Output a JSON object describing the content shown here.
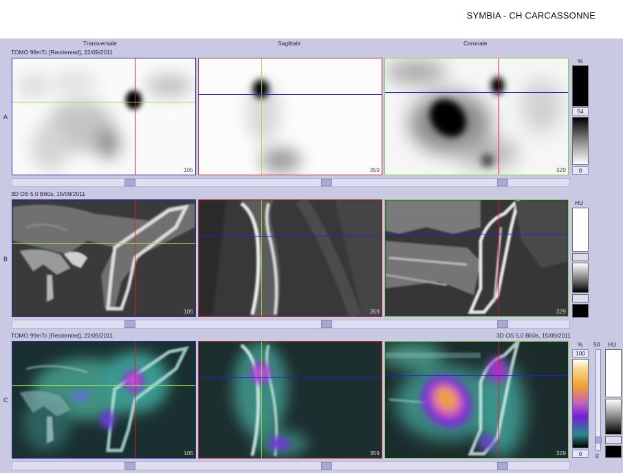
{
  "header": {
    "title": "SYMBIA - CH CARCASSONNE"
  },
  "views": {
    "transverse": "Transversale",
    "sagittal": "Sagittale",
    "coronal": "Coronale"
  },
  "rows": [
    {
      "label": "A",
      "series_left": "TOMO 99mTc [Reoriented], 22/09/2011",
      "series_right": "",
      "slices": [
        "105",
        "359",
        "329"
      ]
    },
    {
      "label": "B",
      "series_left": "3D  OS  5.0  B60s, 15/09/2011",
      "series_right": "",
      "slices": [
        "105",
        "359",
        "329"
      ]
    },
    {
      "label": "C",
      "series_left": "TOMO 99mTc [Reoriented], 22/09/2011",
      "series_right": "3D  OS  5.0  B60s, 15/09/2011",
      "slices": [
        "105",
        "359",
        "329"
      ]
    }
  ],
  "scales": {
    "nm": {
      "unit": "%",
      "value": "54",
      "min": "0"
    },
    "ct": {
      "unit": "HU"
    },
    "fusion": {
      "unit": "%",
      "max": "100",
      "min": "0",
      "mix": "50",
      "mix_min": "0",
      "ct_unit": "HU"
    }
  },
  "colors": {
    "crosshair_red": "#e02020",
    "crosshair_blue": "#2020e0",
    "crosshair_green": "#90e040",
    "background": "#c9c9e3"
  }
}
